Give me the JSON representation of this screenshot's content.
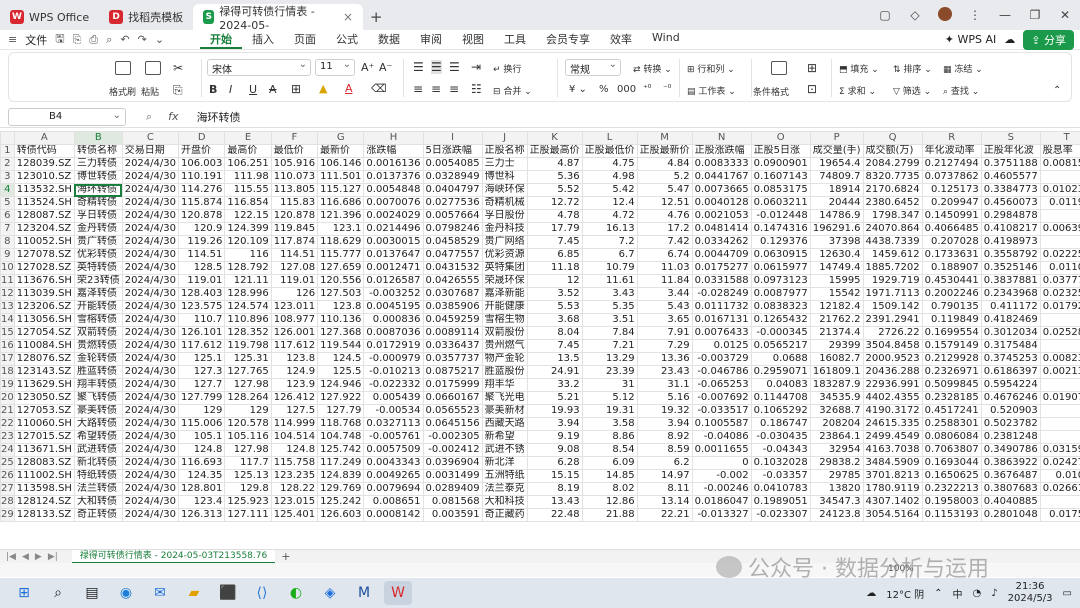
{
  "window": {
    "tabs": [
      {
        "label": "WPS Office",
        "badge": "W",
        "color": "#d8282f"
      },
      {
        "label": "找稻壳模板",
        "badge": "D",
        "color": "#d8282f"
      },
      {
        "label": "禄得可转债行情表 - 2024-05-",
        "badge": "S",
        "color": "#1a9a4a"
      }
    ]
  },
  "menubar": {
    "file_label": "文件",
    "menus": [
      "开始",
      "插入",
      "页面",
      "公式",
      "数据",
      "审阅",
      "视图",
      "工具",
      "会员专享",
      "效率",
      "Wind"
    ],
    "active_menu": "开始",
    "wps_ai": "WPS AI",
    "share": "分享"
  },
  "ribbon": {
    "format_painter": "格式刷",
    "paste": "粘贴",
    "font_name": "宋体",
    "font_size": "11",
    "wrap": "换行",
    "merge": "合并",
    "number_format": "常规",
    "convert": "转换",
    "row_col": "行和列",
    "worksheet": "工作表",
    "cond_format": "条件格式",
    "fill": "填充",
    "sort": "排序",
    "freeze": "冻结",
    "sum": "求和",
    "filter": "筛选",
    "find": "查找"
  },
  "formula_bar": {
    "cell": "B4",
    "fx": "fx",
    "value": "海环转债"
  },
  "grid": {
    "columns": [
      "A",
      "B",
      "C",
      "D",
      "E",
      "F",
      "G",
      "H",
      "I",
      "J",
      "K",
      "L",
      "M",
      "N",
      "O",
      "P",
      "Q",
      "R",
      "S",
      "T",
      "U"
    ],
    "selected_column": "B",
    "selected_row": 4,
    "rows": [
      [
        "转债代码",
        "转债名称",
        "交易日期",
        "开盘价",
        "最高价",
        "最低价",
        "最新价",
        "涨跌幅",
        "5日涨跌幅",
        "正股名称",
        "正股最高价",
        "正股最低价",
        "正股最新价",
        "正股涨跌幅",
        "正股5日涨",
        "成交量(手)",
        "成交额(万)",
        "年化波动率",
        "正股年化波",
        "股息率",
        "转股价"
      ],
      [
        "128039.SZ",
        "三力转债",
        "2024/4/30",
        "106.003",
        "106.251",
        "105.916",
        "106.146",
        "0.0016136",
        "0.0054085",
        "三力士",
        "4.87",
        "4.75",
        "4.84",
        "0.0083333",
        "0.0900901",
        "19654.4",
        "2084.2799",
        "0.2127494",
        "0.3751188",
        "0.008156",
        "89.134"
      ],
      [
        "123010.SZ",
        "博世转债",
        "2024/4/30",
        "110.191",
        "111.98",
        "110.073",
        "111.501",
        "0.0137376",
        "0.0328949",
        "博世科",
        "5.36",
        "4.98",
        "5.2",
        "0.0441767",
        "0.1607143",
        "74809.7",
        "8320.7735",
        "0.0737862",
        "0.4605577",
        "0",
        "111.34"
      ],
      [
        "113532.SH",
        "海环转债",
        "2024/4/30",
        "114.276",
        "115.55",
        "113.805",
        "115.127",
        "0.0054848",
        "0.0404797",
        "海峡环保",
        "5.52",
        "5.42",
        "5.47",
        "0.0073665",
        "0.0853175",
        "18914",
        "2170.6824",
        "0.125173",
        "0.3384773",
        "0.010237",
        "101.48"
      ],
      [
        "113524.SH",
        "奇精转债",
        "2024/4/30",
        "115.874",
        "116.854",
        "115.83",
        "116.686",
        "0.0070076",
        "0.0277536",
        "奇精机械",
        "12.72",
        "12.4",
        "12.51",
        "0.0040128",
        "0.0603211",
        "20444",
        "2380.6452",
        "0.209947",
        "0.4560073",
        "0.01199",
        "93.848"
      ],
      [
        "128087.SZ",
        "孚日转债",
        "2024/4/30",
        "120.878",
        "122.15",
        "120.878",
        "121.396",
        "0.0024029",
        "0.0057664",
        "孚日股份",
        "4.78",
        "4.72",
        "4.76",
        "0.0021053",
        "-0.012448",
        "14786.9",
        "1798.347",
        "0.1450991",
        "0.2984878",
        "0",
        "114.42"
      ],
      [
        "123204.SZ",
        "金丹转债",
        "2024/4/30",
        "120.9",
        "124.399",
        "119.845",
        "123.1",
        "0.0214496",
        "0.0798246",
        "金丹科技",
        "17.79",
        "16.13",
        "17.2",
        "0.0481414",
        "0.1474316",
        "196291.6",
        "24070.864",
        "0.4066485",
        "0.4108217",
        "0.006395",
        "114.06"
      ],
      [
        "110052.SH",
        "贵广转债",
        "2024/4/30",
        "119.26",
        "120.109",
        "117.874",
        "118.629",
        "0.0030015",
        "0.0458529",
        "贵广网络",
        "7.45",
        "7.2",
        "7.42",
        "0.0334262",
        "0.129376",
        "37398",
        "4438.7339",
        "0.207028",
        "0.4198973",
        "0",
        "93.450"
      ],
      [
        "127078.SZ",
        "优彩转债",
        "2024/4/30",
        "114.51",
        "116",
        "114.51",
        "115.777",
        "0.0137647",
        "0.0477557",
        "优彩资源",
        "6.85",
        "6.7",
        "6.74",
        "0.0044709",
        "0.0630915",
        "12630.4",
        "1459.612",
        "0.1733631",
        "0.3558792",
        "0.022255",
        "93.611"
      ],
      [
        "127028.SZ",
        "英特转债",
        "2024/4/30",
        "128.5",
        "128.792",
        "127.08",
        "127.659",
        "0.0012471",
        "0.0431532",
        "英特集团",
        "11.18",
        "10.79",
        "11.03",
        "0.0175277",
        "0.0615977",
        "14749.4",
        "1885.7202",
        "0.188907",
        "0.3525146",
        "0.01106",
        "110.52"
      ],
      [
        "113676.SH",
        "荣23转债",
        "2024/4/30",
        "119.01",
        "121.11",
        "119.01",
        "120.556",
        "0.0126587",
        "0.0426555",
        "荣晟环保",
        "12",
        "11.61",
        "11.84",
        "0.0331588",
        "0.0973123",
        "15995",
        "1929.719",
        "0.4530441",
        "0.3837881",
        "0.037774",
        "98.175"
      ],
      [
        "113039.SH",
        "嘉泽转债",
        "2024/4/30",
        "128.403",
        "128.996",
        "126",
        "127.503",
        "-0.003252",
        "0.0307687",
        "嘉泽新能",
        "3.52",
        "3.43",
        "3.44",
        "-0.028249",
        "0.0087977",
        "15542",
        "1971.7113",
        "0.2002246",
        "0.2343968",
        "0.023255",
        "104.87"
      ],
      [
        "123206.SZ",
        "开能转债",
        "2024/4/30",
        "123.575",
        "124.574",
        "123.011",
        "123.8",
        "0.0045195",
        "0.0385906",
        "开能健康",
        "5.53",
        "5.35",
        "5.43",
        "0.0111732",
        "0.0838323",
        "12182.4",
        "1509.142",
        "0.790135",
        "0.411172",
        "0.017923",
        "96.619"
      ],
      [
        "113056.SH",
        "雪榕转债",
        "2024/4/30",
        "110.7",
        "110.896",
        "108.977",
        "110.136",
        "0.000836",
        "0.0459259",
        "雪榕生物",
        "3.68",
        "3.51",
        "3.65",
        "0.0167131",
        "0.1265432",
        "21762.2",
        "2391.2941",
        "0.119849",
        "0.4182469",
        "0",
        "86.904"
      ],
      [
        "127054.SZ",
        "双箭转债",
        "2024/4/30",
        "126.101",
        "128.352",
        "126.001",
        "127.368",
        "0.0087036",
        "0.0089114",
        "双箭股份",
        "8.04",
        "7.84",
        "7.91",
        "0.0076433",
        "-0.000345",
        "21374.4",
        "2726.22",
        "0.1699554",
        "0.3012034",
        "0.025284",
        "108.95"
      ],
      [
        "110084.SH",
        "贵燃转债",
        "2024/4/30",
        "117.612",
        "119.798",
        "117.612",
        "119.544",
        "0.0172919",
        "0.0336437",
        "贵州燃气",
        "7.45",
        "7.21",
        "7.29",
        "0.0125",
        "0.0565217",
        "29399",
        "3504.8458",
        "0.1579149",
        "0.3175484",
        "0",
        "101.53"
      ],
      [
        "128076.SZ",
        "金轮转债",
        "2024/4/30",
        "125.1",
        "125.31",
        "123.8",
        "124.5",
        "-0.000979",
        "0.0357737",
        "物产金轮",
        "13.5",
        "13.29",
        "13.36",
        "-0.003729",
        "0.0688",
        "16082.7",
        "2000.9523",
        "0.2129928",
        "0.3745253",
        "0.008233",
        "97.093"
      ],
      [
        "123143.SZ",
        "胜蓝转债",
        "2024/4/30",
        "127.3",
        "127.765",
        "124.9",
        "125.5",
        "-0.010213",
        "0.0875217",
        "胜蓝股份",
        "24.91",
        "23.39",
        "23.43",
        "-0.046786",
        "0.2959071",
        "161809.1",
        "20436.288",
        "0.2326971",
        "0.6186397",
        "0.002134",
        "100.68"
      ],
      [
        "113629.SH",
        "翔丰转债",
        "2024/4/30",
        "127.7",
        "127.98",
        "123.9",
        "124.946",
        "-0.022332",
        "0.0175999",
        "翔丰华",
        "33.2",
        "31",
        "31.1",
        "-0.065253",
        "0.04083",
        "183287.9",
        "22936.991",
        "0.5099845",
        "0.5954224",
        "0",
        "111.83"
      ],
      [
        "123050.SZ",
        "聚飞转债",
        "2024/4/30",
        "127.799",
        "128.264",
        "126.412",
        "127.922",
        "0.005439",
        "0.0660167",
        "聚飞光电",
        "5.21",
        "5.12",
        "5.16",
        "-0.007692",
        "0.1144708",
        "34535.9",
        "4402.4355",
        "0.2328185",
        "0.4676246",
        "0.019076",
        "105.76"
      ],
      [
        "127053.SZ",
        "豪美转债",
        "2024/4/30",
        "129",
        "129",
        "127.5",
        "127.79",
        "-0.00534",
        "0.0565523",
        "豪美新材",
        "19.93",
        "19.31",
        "19.32",
        "-0.033517",
        "0.1065292",
        "32688.7",
        "4190.3172",
        "0.4517241",
        "0.520903",
        "0",
        "117.38"
      ],
      [
        "110060.SH",
        "大路转债",
        "2024/4/30",
        "115.006",
        "120.578",
        "114.999",
        "118.768",
        "0.0327113",
        "0.0645156",
        "西藏天路",
        "3.94",
        "3.58",
        "3.94",
        "0.1005587",
        "0.186747",
        "208204",
        "24615.335",
        "0.2588301",
        "0.5023782",
        "0",
        "94.484"
      ],
      [
        "127015.SZ",
        "希望转债",
        "2024/4/30",
        "105.1",
        "105.116",
        "104.514",
        "104.748",
        "-0.005761",
        "-0.002305",
        "新希望",
        "9.19",
        "8.86",
        "8.92",
        "-0.04086",
        "-0.030435",
        "23864.1",
        "2499.4549",
        "0.0806084",
        "0.2381248",
        "0",
        "84.150"
      ],
      [
        "113671.SH",
        "武进转债",
        "2024/4/30",
        "124.8",
        "127.98",
        "124.8",
        "125.742",
        "0.0057509",
        "-0.002412",
        "武进不锈",
        "9.08",
        "8.54",
        "8.59",
        "0.0011655",
        "-0.04343",
        "32954",
        "4163.7038",
        "0.7063807",
        "0.3490786",
        "0.031598",
        "100.46"
      ],
      [
        "128083.SZ",
        "新北转债",
        "2024/4/30",
        "116.693",
        "117.7",
        "115.758",
        "117.249",
        "0.0043343",
        "0.0396904",
        "新北洋",
        "6.28",
        "6.09",
        "6.2",
        "0",
        "0.1032028",
        "29838.2",
        "3484.5909",
        "0.1693044",
        "0.3863922",
        "0.024273",
        "95.531"
      ],
      [
        "111002.SH",
        "特纸转债",
        "2024/4/30",
        "124.35",
        "125.13",
        "123.235",
        "124.839",
        "0.0049265",
        "0.0031499",
        "五洲特纸",
        "15.15",
        "14.85",
        "14.97",
        "-0.002",
        "-0.03357",
        "29785",
        "3701.8213",
        "0.1650625",
        "0.3676487",
        "0.0106",
        "102.95"
      ],
      [
        "113598.SH",
        "法兰转债",
        "2024/4/30",
        "128.801",
        "129.8",
        "128.22",
        "129.769",
        "0.0079694",
        "0.0289409",
        "法兰泰克",
        "8.19",
        "8.02",
        "8.11",
        "-0.00246",
        "0.0410783",
        "13820",
        "1780.9119",
        "0.2322213",
        "0.3807683",
        "0.026611",
        "105.59"
      ],
      [
        "128124.SZ",
        "大和转债",
        "2024/4/30",
        "123.4",
        "125.923",
        "123.015",
        "125.242",
        "0.008651",
        "0.081568",
        "大和科技",
        "13.43",
        "12.86",
        "13.14",
        "0.0186047",
        "0.1989051",
        "34547.3",
        "4307.1402",
        "0.1958003",
        "0.4040885",
        "0",
        "110.60"
      ],
      [
        "128133.SZ",
        "奇正转债",
        "2024/4/30",
        "126.313",
        "127.111",
        "125.401",
        "126.603",
        "0.0008142",
        "0.003591",
        "奇正藏药",
        "22.48",
        "21.88",
        "22.21",
        "-0.013327",
        "-0.023307",
        "24123.8",
        "3054.5164",
        "0.1153193",
        "0.2801048",
        "0.01756",
        "110.52"
      ]
    ]
  },
  "sheet": {
    "tab_label": "禄得可转债行情表 - 2024-05-03T213558.76"
  },
  "statusbar": {
    "zoom": "100%"
  },
  "watermark": "公众号 · 数据分析与运用",
  "taskbar": {
    "weather": "12°C 阴",
    "time": "21:36",
    "date": "2024/5/3"
  }
}
